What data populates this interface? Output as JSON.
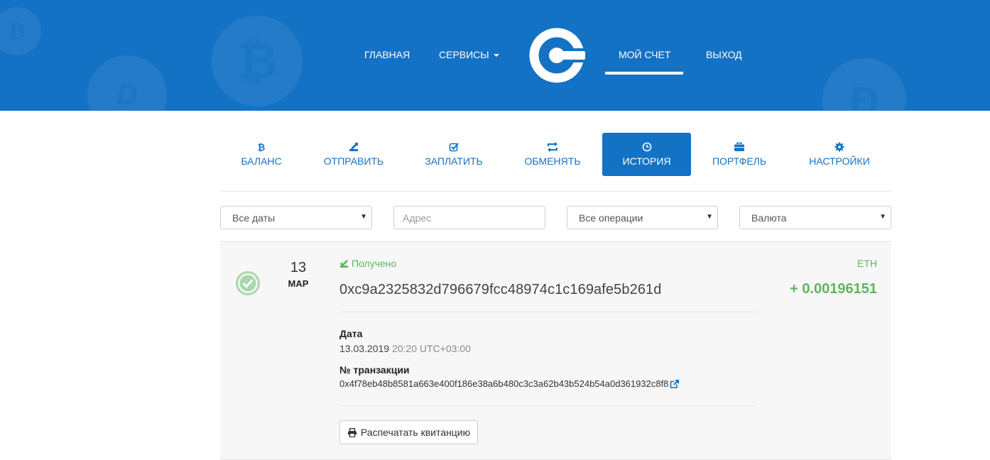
{
  "header": {
    "nav": {
      "home": "ГЛАВНАЯ",
      "services": "СЕРВИСЫ",
      "account": "МОЙ СЧЕТ",
      "logout": "ВЫХОД"
    },
    "background_coins": [
      "B",
      "bitcoin",
      "dash",
      "D"
    ],
    "logo": "logo",
    "color": "#1472c4"
  },
  "tabs": [
    {
      "label": "БАЛАНС",
      "icon": "bitcoin-icon"
    },
    {
      "label": "ОТПРАВИТЬ",
      "icon": "send-icon"
    },
    {
      "label": "ЗАПЛАТИТЬ",
      "icon": "pay-check-icon"
    },
    {
      "label": "ОБМЕНЯТЬ",
      "icon": "exchange-icon"
    },
    {
      "label": "ИСТОРИЯ",
      "icon": "clock-icon",
      "active": true
    },
    {
      "label": "ПОРТФЕЛЬ",
      "icon": "briefcase-icon"
    },
    {
      "label": "НАСТРОЙКИ",
      "icon": "gear-icon"
    }
  ],
  "filters": {
    "dates": "Все даты",
    "address_placeholder": "Адрес",
    "operations": "Все операции",
    "currency": "Валюта"
  },
  "transaction": {
    "day": "13",
    "month": "МАР",
    "status": "Получено",
    "address": "0xc9a2325832d796679fcc48974c1c169afe5b261d",
    "currency": "ETH",
    "amount": "+ 0.00196151",
    "date_label": "Дата",
    "date": "13.03.2019",
    "time": "20:20 UTC+03:00",
    "tx_label": "№ транзакции",
    "tx_hash": "0x4f78eb48b8581a663e400f186e38a6b480c3c3a62b43b524b54a0d361932c8f8",
    "print_button": "Распечатать квитанцию"
  },
  "colors": {
    "accent": "#1472c4",
    "success": "#5cb85c",
    "card_bg": "#f7f7f7"
  }
}
